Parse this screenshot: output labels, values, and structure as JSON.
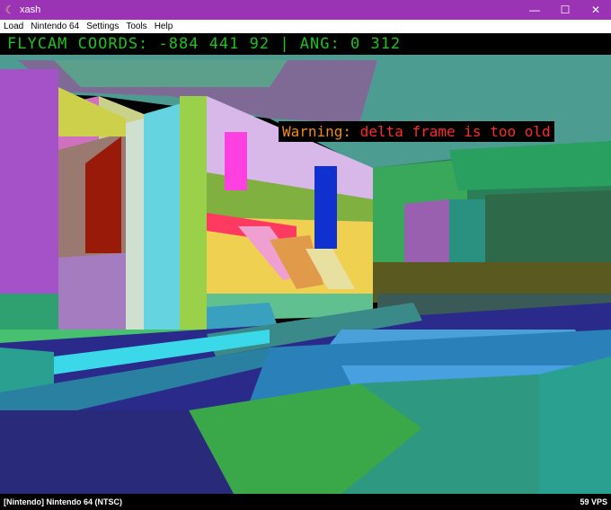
{
  "window": {
    "title": "xash",
    "controls": {
      "minimize": "—",
      "maximize": "☐",
      "close": "✕"
    }
  },
  "menu": {
    "items": [
      "Load",
      "Nintendo 64",
      "Settings",
      "Tools",
      "Help"
    ]
  },
  "overlay": {
    "coords": "FLYCAM COORDS: -884 441 92 | ANG: 0 312",
    "warning_label": "Warning:",
    "warning_message": "delta frame is too old"
  },
  "status": {
    "left": "[Nintendo] Nintendo 64 (NTSC)",
    "right": "59 VPS"
  },
  "colors": {
    "titlebar": "#9a34b4",
    "coords_text": "#1ec21e",
    "warning_label": "#f08a1e",
    "warning_message": "#ff2a2a"
  }
}
